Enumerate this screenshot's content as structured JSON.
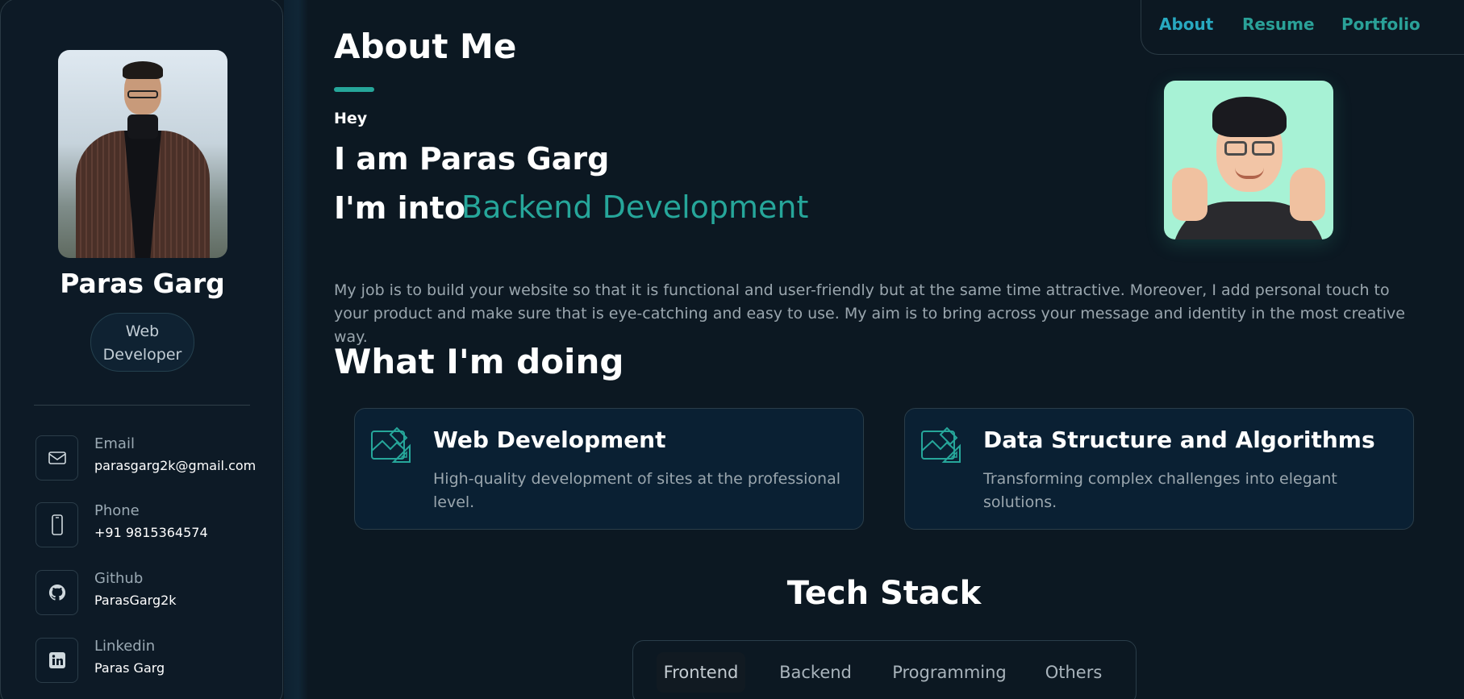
{
  "profile": {
    "name": "Paras Garg",
    "role": "Web Developer"
  },
  "contacts": [
    {
      "label": "Email",
      "value": "parasgarg2k@gmail.com",
      "icon": "mail-icon"
    },
    {
      "label": "Phone",
      "value": "+91 9815364574",
      "icon": "phone-icon"
    },
    {
      "label": "Github",
      "value": "ParasGarg2k",
      "icon": "github-icon"
    },
    {
      "label": "Linkedin",
      "value": "Paras Garg",
      "icon": "linkedin-icon"
    }
  ],
  "nav": {
    "items": [
      "About",
      "Resume",
      "Portfolio"
    ],
    "active": "About"
  },
  "about": {
    "title": "About Me",
    "greeting": "Hey",
    "intro": "I am Paras Garg",
    "into_prefix": "I'm into",
    "into_role": "Backend Development",
    "text": "My job is to build your website so that it is functional and user-friendly but at the same time attractive. Moreover, I add personal touch to your product and make sure that is eye-catching and easy to use. My aim is to bring across your message and identity in the most creative way."
  },
  "services": {
    "title": "What I'm doing",
    "items": [
      {
        "title": "Web Development",
        "description": "High-quality development of sites at the professional level.",
        "icon": "design-tools-icon"
      },
      {
        "title": "Data Structure and Algorithms",
        "description": "Transforming complex challenges into elegant solutions.",
        "icon": "design-tools-icon"
      }
    ]
  },
  "tech_stack": {
    "title": "Tech Stack",
    "tabs": [
      "Frontend",
      "Backend",
      "Programming",
      "Others"
    ],
    "active": "Frontend"
  },
  "colors": {
    "accent": "#26a69a",
    "nav_active": "#28a9c0",
    "background": "#0c1822",
    "card": "#0a2033"
  }
}
